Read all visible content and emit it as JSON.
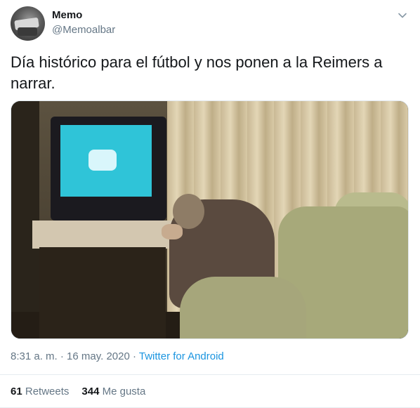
{
  "author": {
    "name": "Memo",
    "handle": "@Memoalbar"
  },
  "tweet": {
    "text": "Día histórico para el fútbol y nos ponen a la Reimers a narrar."
  },
  "meta": {
    "time": "8:31 a. m.",
    "separator1": " · ",
    "date": "16 may. 2020",
    "separator2": " · ",
    "source": "Twitter for Android"
  },
  "stats": {
    "retweets_count": "61",
    "retweets_label": "Retweets",
    "likes_count": "344",
    "likes_label": "Me gusta"
  },
  "icons": {
    "menu": "chevron-down-icon"
  },
  "colors": {
    "link": "#1b95e0",
    "secondary_text": "#657786",
    "primary_text": "#14171a"
  }
}
